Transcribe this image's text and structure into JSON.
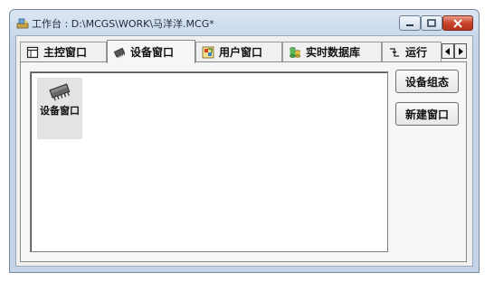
{
  "window": {
    "title": "工作台 : D:\\MCGS\\WORK\\马洋洋.MCG*"
  },
  "tabs": [
    {
      "label": "主控窗口",
      "icon": "main-window-icon",
      "active": false
    },
    {
      "label": "设备窗口",
      "icon": "device-chip-icon",
      "active": true
    },
    {
      "label": "用户窗口",
      "icon": "user-window-icon",
      "active": false
    },
    {
      "label": "实时数据库",
      "icon": "database-icon",
      "active": false
    },
    {
      "label": "运行",
      "icon": "run-strategy-icon",
      "active": false
    }
  ],
  "canvas_items": [
    {
      "label": "设备窗口",
      "icon": "device-chip-icon"
    }
  ],
  "buttons": {
    "device_config": "设备组态",
    "new_window": "新建窗口"
  },
  "colors": {
    "title_bar": "#c9d8ea",
    "close_button": "#c8432c",
    "panel_background": "#f0f0f0"
  }
}
